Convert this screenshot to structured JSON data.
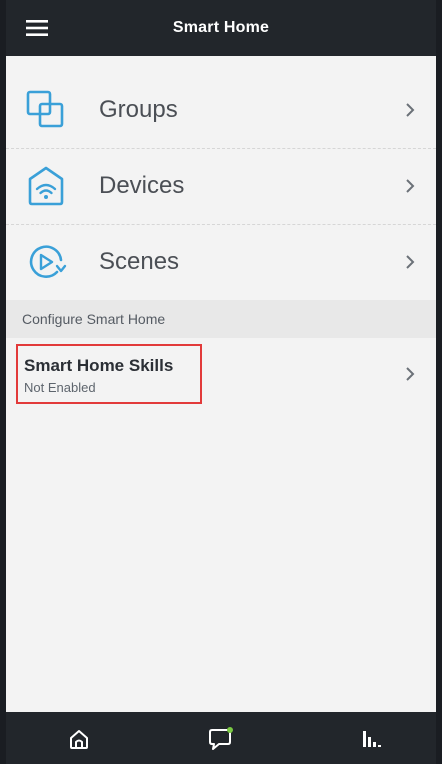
{
  "header": {
    "title": "Smart Home"
  },
  "items": [
    {
      "label": "Groups",
      "icon": "groups-icon"
    },
    {
      "label": "Devices",
      "icon": "devices-icon"
    },
    {
      "label": "Scenes",
      "icon": "scenes-icon"
    }
  ],
  "section": {
    "title": "Configure Smart Home"
  },
  "skills": {
    "title": "Smart Home Skills",
    "status": "Not Enabled"
  },
  "nav": {
    "items": [
      "home-icon",
      "chat-icon",
      "activity-icon"
    ]
  },
  "colors": {
    "accent": "#3aa0d8",
    "highlight": "#e23a3a",
    "bar": "#22262b",
    "badge": "#7ac943"
  }
}
